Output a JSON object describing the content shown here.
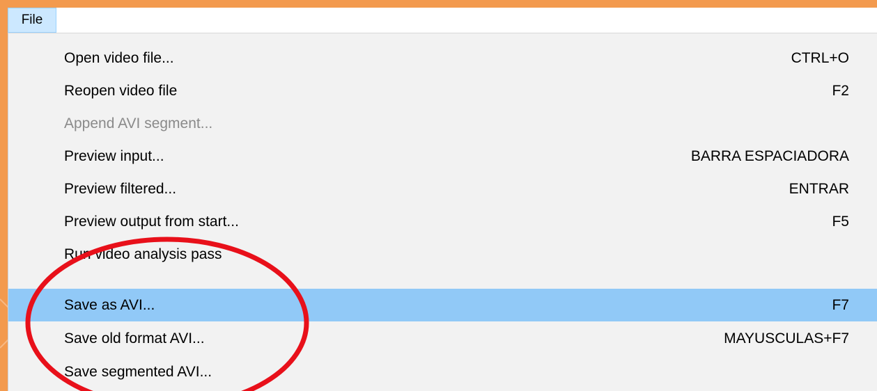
{
  "menubar": {
    "file_label": "File"
  },
  "menu": {
    "items": [
      {
        "label": "Open video file...",
        "shortcut": "CTRL+O",
        "state": "normal"
      },
      {
        "label": "Reopen video file",
        "shortcut": "F2",
        "state": "normal"
      },
      {
        "label": "Append AVI segment...",
        "shortcut": "",
        "state": "disabled"
      },
      {
        "label": "Preview input...",
        "shortcut": "BARRA ESPACIADORA",
        "state": "normal"
      },
      {
        "label": "Preview filtered...",
        "shortcut": "ENTRAR",
        "state": "normal"
      },
      {
        "label": "Preview output from start...",
        "shortcut": "F5",
        "state": "normal"
      },
      {
        "label": "Run video analysis pass",
        "shortcut": "",
        "state": "normal"
      },
      {
        "label": "Save as AVI...",
        "shortcut": "F7",
        "state": "highlighted"
      },
      {
        "label": "Save old format AVI...",
        "shortcut": "MAYUSCULAS+F7",
        "state": "normal"
      },
      {
        "label": "Save segmented AVI...",
        "shortcut": "",
        "state": "normal"
      }
    ]
  },
  "colors": {
    "slide_background": "#f39a4e",
    "menu_background": "#f2f2f2",
    "highlight": "#91c9f7",
    "annotation": "#e8101a",
    "disabled_text": "#8a8a8a"
  }
}
